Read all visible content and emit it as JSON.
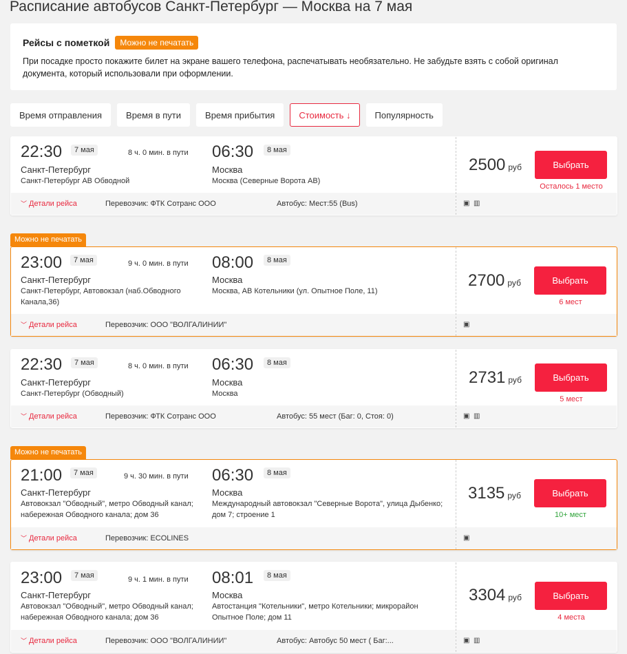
{
  "page_title": "Расписание автобусов Санкт-Петербург — Москва на 7 мая",
  "notice": {
    "title": "Рейсы с пометкой",
    "badge": "Можно не печатать",
    "text": "При посадке просто покажите билет на экране вашего телефона, распечатывать необязательно. Не забудьте взять с собой оригинал документа, который использовали при оформлении."
  },
  "sort": [
    "Время отправления",
    "Время в пути",
    "Время прибытия",
    "Стоимость ↓",
    "Популярность"
  ],
  "flag_label": "Можно не печатать",
  "details_label": "Детали рейса",
  "select_label": "Выбрать",
  "currency": "руб",
  "colors": {
    "accent": "#f5213f",
    "badge": "#f5870b",
    "seats_green": "#2fa33a"
  },
  "trips": [
    {
      "dep_time": "22:30",
      "dep_date": "7 мая",
      "duration": "8 ч. 0 мин. в пути",
      "arr_time": "06:30",
      "arr_date": "8 мая",
      "dep_city": "Санкт-Петербург",
      "dep_station": "Санкт-Петербург АВ Обводной",
      "arr_city": "Москва",
      "arr_station": "Москва (Северные Ворота АВ)",
      "carrier": "Перевозчик: ФТК Сотранс ООО",
      "bus": "Автобус: Мест:55 (Bus)",
      "price": "2500",
      "seats": "Осталось 1 место"
    },
    {
      "dep_time": "23:00",
      "dep_date": "7 мая",
      "duration": "9 ч. 0 мин. в пути",
      "arr_time": "08:00",
      "arr_date": "8 мая",
      "dep_city": "Санкт-Петербург",
      "dep_station": "Санкт-Петербург, Автовокзал (наб.Обводного Канала,36)",
      "arr_city": "Москва",
      "arr_station": "Москва, АВ Котельники (ул. Опытное Поле, 11)",
      "carrier": "Перевозчик: ООО \"ВОЛГАЛИНИИ\"",
      "bus": "",
      "price": "2700",
      "seats": "6 мест"
    },
    {
      "dep_time": "22:30",
      "dep_date": "7 мая",
      "duration": "8 ч. 0 мин. в пути",
      "arr_time": "06:30",
      "arr_date": "8 мая",
      "dep_city": "Санкт-Петербург",
      "dep_station": "Санкт-Петербург (Обводный)",
      "arr_city": "Москва",
      "arr_station": "Москва",
      "carrier": "Перевозчик: ФТК Сотранс ООО",
      "bus": "Автобус: 55 мест (Баг: 0, Стоя: 0)",
      "price": "2731",
      "seats": "5 мест"
    },
    {
      "dep_time": "21:00",
      "dep_date": "7 мая",
      "duration": "9 ч. 30 мин. в пути",
      "arr_time": "06:30",
      "arr_date": "8 мая",
      "dep_city": "Санкт-Петербург",
      "dep_station": "Автовокзал \"Обводный\", метро Обводный канал; набережная Обводного канала; дом 36",
      "arr_city": "Москва",
      "arr_station": "Международный автовокзал \"Северные Ворота\", улица Дыбенко; дом 7; строение 1",
      "carrier": "Перевозчик: ECOLINES",
      "bus": "",
      "price": "3135",
      "seats": "10+ мест"
    },
    {
      "dep_time": "23:00",
      "dep_date": "7 мая",
      "duration": "9 ч. 1 мин. в пути",
      "arr_time": "08:01",
      "arr_date": "8 мая",
      "dep_city": "Санкт-Петербург",
      "dep_station": "Автовокзал \"Обводный\", метро Обводный канал; набережная Обводного канала; дом 36",
      "arr_city": "Москва",
      "arr_station": "Автостанция \"Котельники\", метро Котельники; микрорайон Опытное Поле; дом 11",
      "carrier": "Перевозчик: ООО \"ВОЛГАЛИНИИ\"",
      "bus": "Автобус: Автобус 50 мест ( Баг:...",
      "price": "3304",
      "seats": "4 места"
    }
  ]
}
